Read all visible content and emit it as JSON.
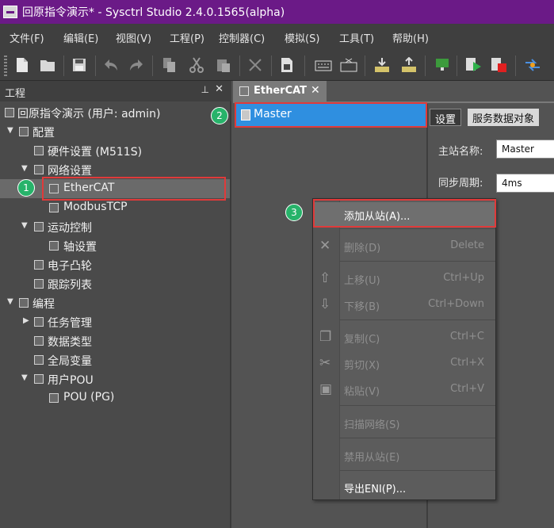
{
  "window": {
    "title": "回原指令演示* - Sysctrl Studio 2.4.0.1565(alpha)"
  },
  "menu": [
    {
      "label": "文件(F)"
    },
    {
      "label": "编辑(E)"
    },
    {
      "label": "视图(V)"
    },
    {
      "label": "工程(P)"
    },
    {
      "label": "控制器(C)"
    },
    {
      "label": "模拟(S)"
    },
    {
      "label": "工具(T)"
    },
    {
      "label": "帮助(H)"
    }
  ],
  "toolbar": {
    "icons": [
      "new-file-icon",
      "open-folder-icon",
      "save-icon",
      "undo-icon",
      "redo-icon",
      "copy-icon",
      "cut-icon",
      "paste-icon",
      "delete-icon",
      "build-icon",
      "keyboard-icon",
      "keyboard-remove-icon",
      "download-icon",
      "upload-icon",
      "monitor-icon",
      "run-icon",
      "stop-icon",
      "transfer-icon"
    ]
  },
  "project_panel": {
    "title": "工程",
    "pin_glyph": "📌",
    "close_glyph": "✕",
    "tree": [
      {
        "label": "回原指令演示 (用户: admin)",
        "icon": "project-icon"
      },
      {
        "label": "配置",
        "icon": "config-icon",
        "expanded": true
      },
      {
        "label": "硬件设置 (M511S)",
        "icon": "hardware-icon"
      },
      {
        "label": "网络设置",
        "icon": "network-icon",
        "expanded": true
      },
      {
        "label": "EtherCAT",
        "icon": "ethercat-icon",
        "selected": true
      },
      {
        "label": "ModbusTCP",
        "icon": "modbus-icon"
      },
      {
        "label": "运动控制",
        "icon": "motion-icon",
        "expanded": true
      },
      {
        "label": "轴设置",
        "icon": "axis-gear-icon"
      },
      {
        "label": "电子凸轮",
        "icon": "cam-icon"
      },
      {
        "label": "跟踪列表",
        "icon": "trace-icon"
      },
      {
        "label": "编程",
        "icon": "program-icon",
        "expanded": true
      },
      {
        "label": "任务管理",
        "icon": "task-icon",
        "expanded": false
      },
      {
        "label": "数据类型",
        "icon": "datatype-icon"
      },
      {
        "label": "全局变量",
        "icon": "global-var-icon"
      },
      {
        "label": "用户POU",
        "icon": "pou-folder-icon",
        "expanded": true
      },
      {
        "label": "POU (PG)",
        "icon": "pou-icon"
      }
    ]
  },
  "editor": {
    "tab_label": "EtherCAT",
    "tab_close": "✕",
    "master_label": "Master",
    "subtabs": [
      {
        "label": "设置",
        "active": true
      },
      {
        "label": "服务数据对象",
        "active": false
      }
    ],
    "properties": [
      {
        "label": "主站名称:",
        "value": "Master"
      },
      {
        "label": "同步周期:",
        "value": "4ms"
      }
    ]
  },
  "context_menu": {
    "items": [
      {
        "label": "添加从站(A)...",
        "shortcut": "",
        "icon": "",
        "enabled": true
      },
      {
        "label": "删除(D)",
        "shortcut": "Delete",
        "icon": "delete-icon",
        "enabled": false
      },
      {
        "label": "上移(U)",
        "shortcut": "Ctrl+Up",
        "icon": "arrow-up-icon",
        "enabled": false
      },
      {
        "label": "下移(B)",
        "shortcut": "Ctrl+Down",
        "icon": "arrow-down-icon",
        "enabled": false
      },
      {
        "label": "复制(C)",
        "shortcut": "Ctrl+C",
        "icon": "copy-icon",
        "enabled": false
      },
      {
        "label": "剪切(X)",
        "shortcut": "Ctrl+X",
        "icon": "cut-icon",
        "enabled": false
      },
      {
        "label": "粘贴(V)",
        "shortcut": "Ctrl+V",
        "icon": "paste-icon",
        "enabled": false
      },
      {
        "label": "扫描网络(S)",
        "shortcut": "",
        "icon": "",
        "enabled": false
      },
      {
        "label": "禁用从站(E)",
        "shortcut": "",
        "icon": "",
        "enabled": false
      },
      {
        "label": "导出ENI(P)...",
        "shortcut": "",
        "icon": "",
        "enabled": true
      }
    ]
  },
  "callouts": [
    "1",
    "2",
    "3"
  ],
  "colors": {
    "titlebar": "#6b1a87",
    "highlight_box": "#e03a3a",
    "badge": "#27b36a",
    "selection": "#2f8fe0"
  }
}
